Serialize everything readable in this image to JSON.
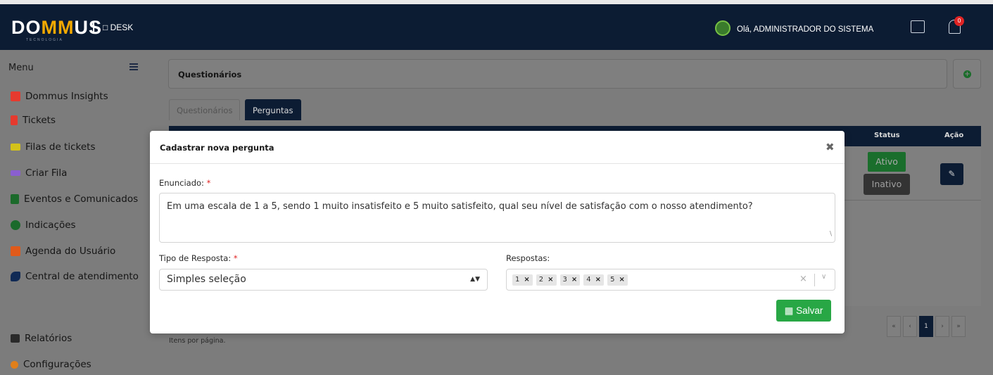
{
  "header": {
    "logo": "DOMMUS",
    "logo_sub": "TECNOLOGIA",
    "separator": "|",
    "app_name": "DESK",
    "greeting": "Olá, ADMINISTRADOR DO SISTEMA",
    "notification_count": "0"
  },
  "sidebar": {
    "menu_label": "Menu",
    "items": [
      {
        "label": "Dommus Insights",
        "icon": "dashboard-icon",
        "color": "#e63a2e"
      },
      {
        "label": "Tickets",
        "icon": "ticket-icon",
        "color": "#e63a2e"
      },
      {
        "label": "Filas de tickets",
        "icon": "list-icon",
        "color": "#d4c21a"
      },
      {
        "label": "Criar Fila",
        "icon": "add-list-icon",
        "color": "#8a5fd0"
      },
      {
        "label": "Eventos e Comunicados",
        "icon": "calendar-icon",
        "color": "#1b6a2b"
      },
      {
        "label": "Indicações",
        "icon": "user-plus-icon",
        "color": "#1b6a2b"
      },
      {
        "label": "Agenda do Usuário",
        "icon": "agenda-icon",
        "color": "#e05a1a"
      },
      {
        "label": "Central de atendimento",
        "icon": "phone-icon",
        "color": "#102a55"
      }
    ],
    "bottom_items": [
      {
        "label": "Relatórios",
        "icon": "grid-icon",
        "color": "#2a2a2a"
      },
      {
        "label": "Configurações",
        "icon": "gear-icon",
        "color": "#e07f1a"
      }
    ]
  },
  "main": {
    "page_title": "Questionários",
    "tabs": [
      {
        "label": "Questionários",
        "active": false
      },
      {
        "label": "Perguntas",
        "active": true
      }
    ],
    "table": {
      "headers": {
        "status": "Status",
        "action": "Ação"
      },
      "row": {
        "status_active": "Ativo",
        "status_inactive": "Inativo"
      }
    },
    "per_page_label": "Itens por página.",
    "pagination": [
      "«",
      "‹",
      "1",
      "›",
      "»"
    ]
  },
  "modal": {
    "title": "Cadastrar nova pergunta",
    "close": "✖",
    "statement_label": "Enunciado:",
    "statement_value": "Em uma escala de 1 a 5, sendo 1 muito insatisfeito e 5 muito satisfeito, qual seu nível de satisfação com o nosso atendimento?",
    "response_type_label": "Tipo de Resposta:",
    "response_type_value": "Simples seleção",
    "answers_label": "Respostas:",
    "answers": [
      "1",
      "2",
      "3",
      "4",
      "5"
    ],
    "required_marker": "*",
    "save_label": "Salvar"
  }
}
